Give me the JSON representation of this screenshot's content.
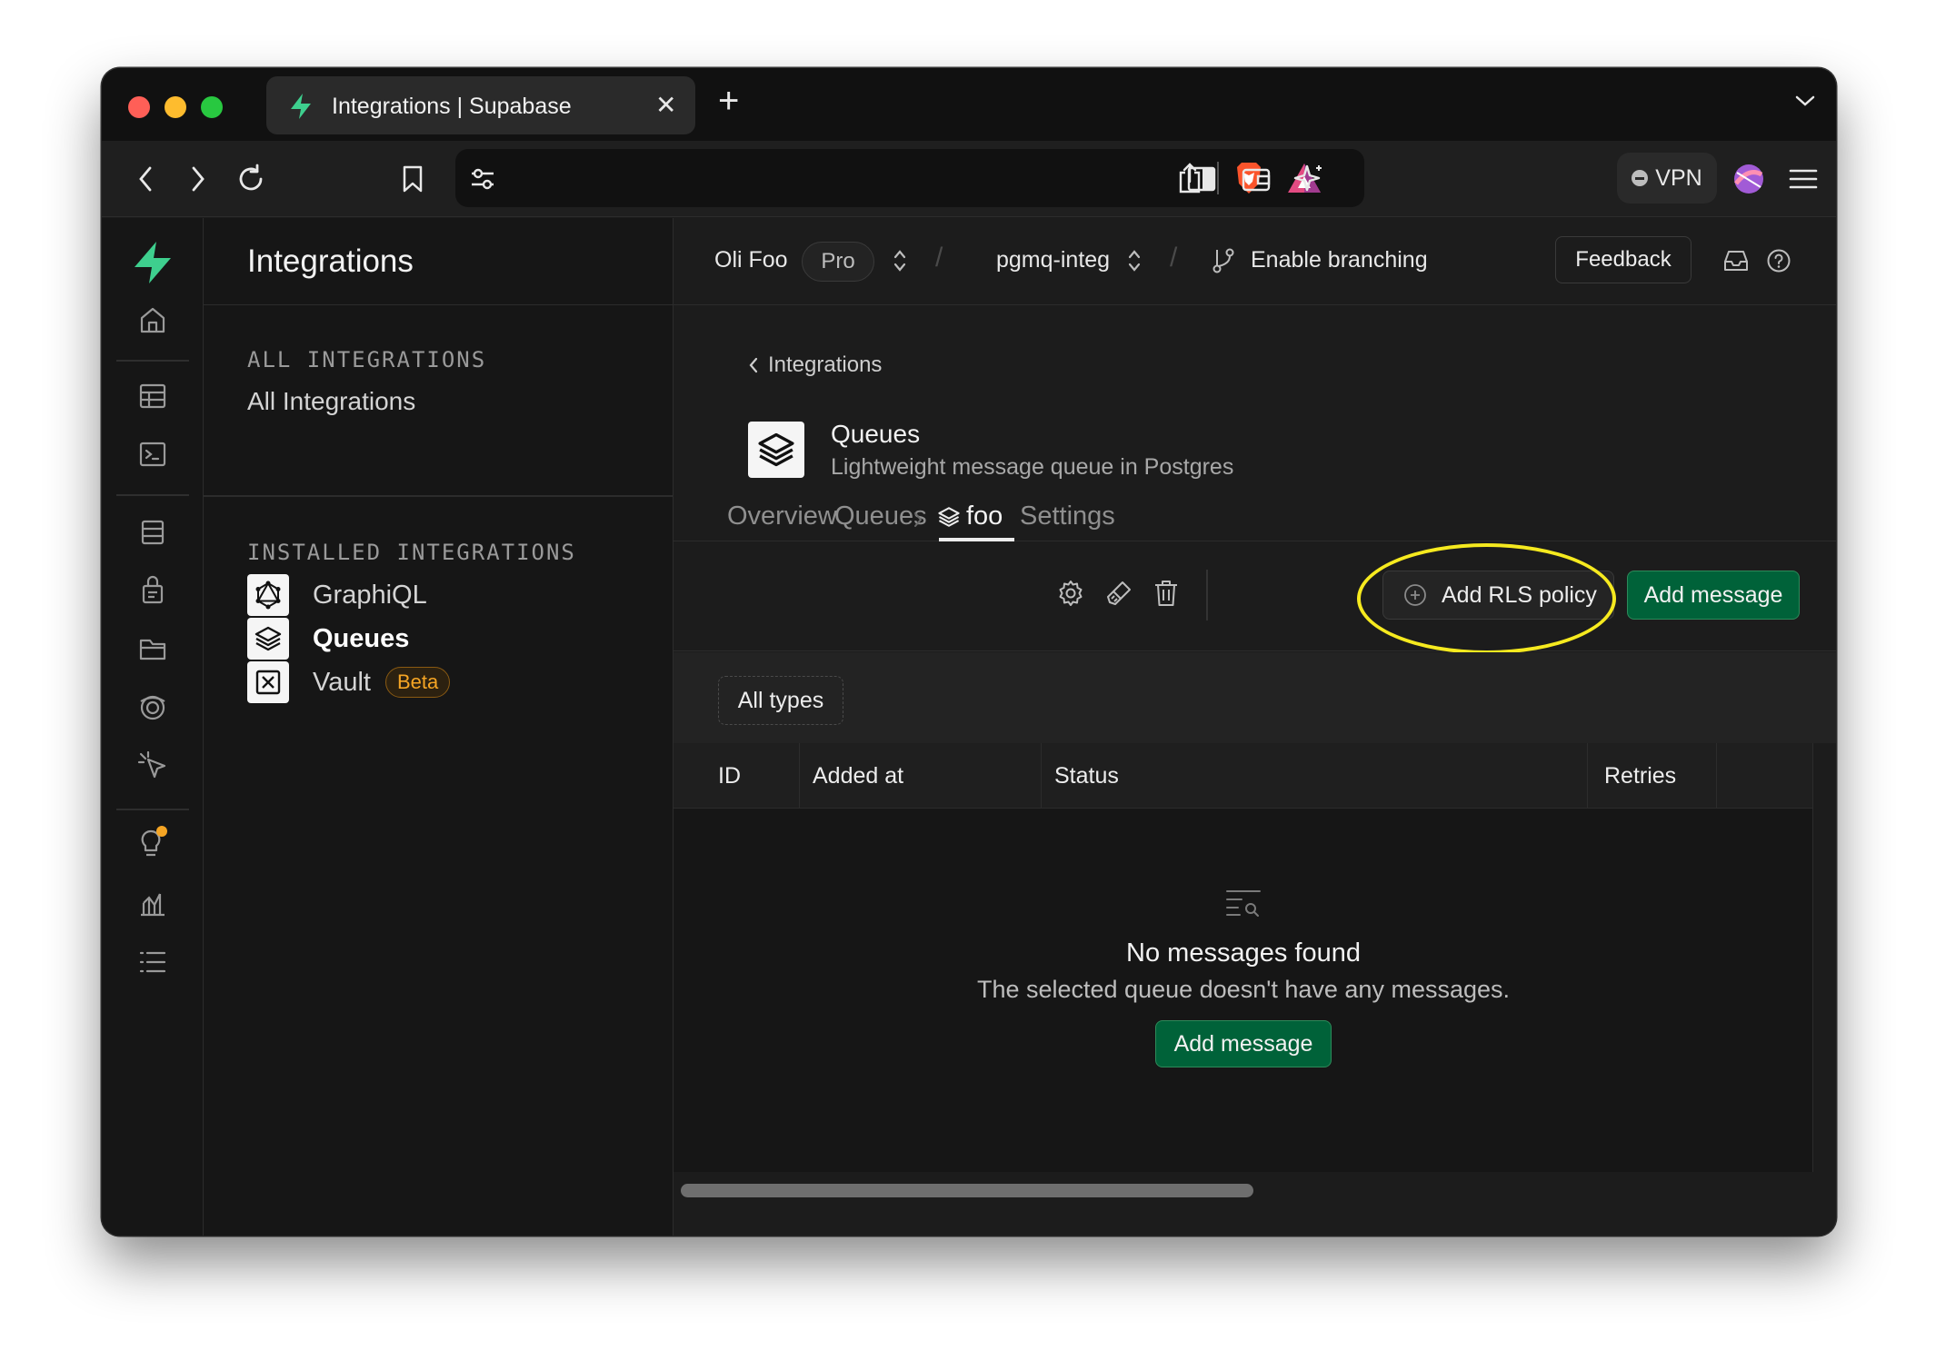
{
  "browser": {
    "tab_title": "Integrations | Supabase",
    "vpn_label": "VPN"
  },
  "sidebar": {
    "title": "Integrations",
    "all_caption": "ALL INTEGRATIONS",
    "all_link": "All Integrations",
    "installed_caption": "INSTALLED INTEGRATIONS",
    "installed": [
      {
        "label": "GraphiQL",
        "icon": "graphql-icon"
      },
      {
        "label": "Queues",
        "icon": "layers-icon",
        "active": true
      },
      {
        "label": "Vault",
        "icon": "vault-icon",
        "badge": "Beta"
      }
    ]
  },
  "topbar": {
    "org": "Oli Foo",
    "plan": "Pro",
    "project": "pgmq-integ",
    "branching": "Enable branching",
    "feedback": "Feedback"
  },
  "page": {
    "back_label": "Integrations",
    "title": "Queues",
    "subtitle": "Lightweight message queue in Postgres",
    "tabs": [
      "Overview",
      "Queues",
      "foo",
      "Settings"
    ],
    "active_tab": "foo"
  },
  "actions": {
    "rls_label": "Add RLS policy",
    "add_message": "Add message"
  },
  "filter": {
    "all_types": "All types"
  },
  "table": {
    "columns": [
      "ID",
      "Added at",
      "Status",
      "Retries"
    ],
    "rows": []
  },
  "empty_state": {
    "title": "No messages found",
    "subtitle": "The selected queue doesn't have any messages.",
    "button": "Add message"
  },
  "colors": {
    "brand_green": "#3ecf8e",
    "button_green": "#006239",
    "highlight_yellow": "#f6ea1f",
    "beta_orange": "#f5a524"
  }
}
